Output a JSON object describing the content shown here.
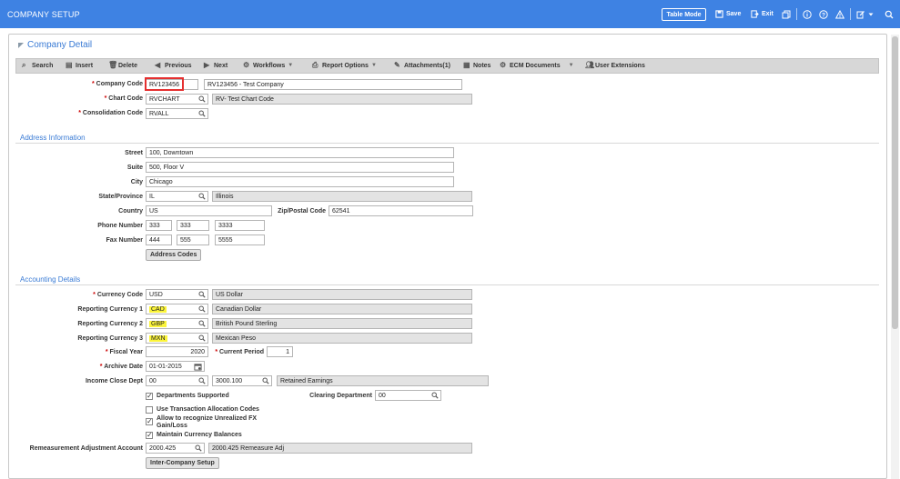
{
  "window": {
    "title": "COMPANY SETUP"
  },
  "topbar": {
    "table_mode": "Table Mode",
    "save": "Save",
    "exit": "Exit"
  },
  "panel": {
    "title": "Company Detail"
  },
  "toolbar": {
    "search": "Search",
    "insert": "Insert",
    "delete": "Delete",
    "previous": "Previous",
    "next": "Next",
    "workflows": "Workflows",
    "report_options": "Report Options",
    "attachments": "Attachments(1)",
    "notes": "Notes",
    "ecm_documents": "ECM Documents",
    "user_extensions": "User Extensions"
  },
  "header_fields": {
    "company_code": {
      "label": "Company Code",
      "value": "RV123456",
      "desc": "RV123456 - Test Company"
    },
    "chart_code": {
      "label": "Chart Code",
      "value": "RVCHART",
      "desc": "RV- Test Chart Code"
    },
    "consolidation_code": {
      "label": "Consolidation Code",
      "value": "RVALL"
    }
  },
  "address": {
    "section_title": "Address Information",
    "street": {
      "label": "Street",
      "value": "100, Downtown"
    },
    "suite": {
      "label": "Suite",
      "value": "500, Floor V"
    },
    "city": {
      "label": "City",
      "value": "Chicago"
    },
    "state": {
      "label": "State/Province",
      "value": "IL",
      "desc": "Illinois"
    },
    "country": {
      "label": "Country",
      "value": "US"
    },
    "zip": {
      "label": "Zip/Postal Code",
      "value": "62541"
    },
    "phone": {
      "label": "Phone Number",
      "p1": "333",
      "p2": "333",
      "p3": "3333"
    },
    "fax": {
      "label": "Fax Number",
      "p1": "444",
      "p2": "555",
      "p3": "5555"
    },
    "address_codes_button": "Address Codes"
  },
  "accounting": {
    "section_title": "Accounting Details",
    "currency_code": {
      "label": "Currency Code",
      "value": "USD",
      "desc": "US Dollar"
    },
    "reporting_currency_1": {
      "label": "Reporting Currency 1",
      "value": "CAD",
      "desc": "Canadian Dollar"
    },
    "reporting_currency_2": {
      "label": "Reporting Currency 2",
      "value": "GBP",
      "desc": "British Pound Sterling"
    },
    "reporting_currency_3": {
      "label": "Reporting Currency 3",
      "value": "MXN",
      "desc": "Mexican Peso"
    },
    "fiscal_year": {
      "label": "Fiscal Year",
      "value": "2020"
    },
    "current_period": {
      "label": "Current Period",
      "value": "1"
    },
    "archive_date": {
      "label": "Archive Date",
      "value": "01-01-2015"
    },
    "income_close_dept": {
      "label": "Income Close Dept",
      "value": "00",
      "account": "3000.100",
      "desc": "Retained Earnings"
    },
    "departments_supported": {
      "label": "Departments Supported",
      "checked": true
    },
    "clearing_department": {
      "label": "Clearing Department",
      "value": "00"
    },
    "use_transaction_allocation": {
      "label": "Use Transaction Allocation Codes",
      "checked": false
    },
    "unrealized_fx_line1": "Allow to recognize Unrealized FX",
    "unrealized_fx_line2": "Gain/Loss",
    "maintain_currency_balances": {
      "label": "Maintain Currency Balances",
      "checked": true
    },
    "remeasurement_adjustment": {
      "label": "Remeasurement Adjustment Account",
      "value": "2000.425",
      "desc": "2000.425 Remeasure Adj"
    },
    "inter_company_button": "Inter-Company Setup"
  }
}
